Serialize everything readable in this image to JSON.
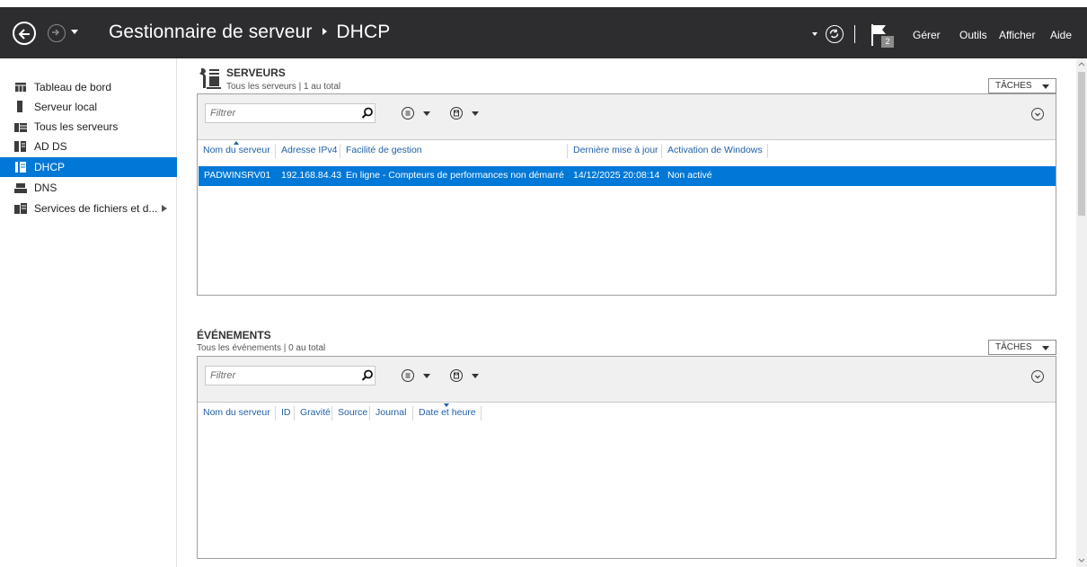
{
  "titlebar": {
    "title": "Gestionnaire de serveur",
    "section": "DHCP",
    "flag_count": "2",
    "menu": [
      "Gérer",
      "Outils",
      "Afficher",
      "Aide"
    ]
  },
  "sidebar": {
    "items": [
      {
        "label": "Tableau de bord",
        "icon": "dashboard-icon"
      },
      {
        "label": "Serveur local",
        "icon": "server-icon"
      },
      {
        "label": "Tous les serveurs",
        "icon": "servers-icon"
      },
      {
        "label": "AD DS",
        "icon": "adds-icon"
      },
      {
        "label": "DHCP",
        "icon": "dhcp-icon",
        "selected": true
      },
      {
        "label": "DNS",
        "icon": "dns-icon"
      },
      {
        "label": "Services de fichiers et d...",
        "icon": "file-services-icon",
        "has_submenu": true
      }
    ]
  },
  "servers": {
    "title": "SERVEURS",
    "subtitle": "Tous les serveurs | 1 au total",
    "tasks_label": "TÂCHES",
    "filter_placeholder": "Filtrer",
    "columns": [
      "Nom du serveur",
      "Adresse IPv4",
      "Facilité de gestion",
      "Dernière mise à jour",
      "Activation de Windows"
    ],
    "rows": [
      [
        "PADWINSRV01",
        "192.168.84.43",
        "En ligne - Compteurs de performances non démarré",
        "14/12/2025 20:08:14",
        "Non activé"
      ]
    ]
  },
  "events": {
    "title": "ÉVÉNEMENTS",
    "subtitle": "Tous les événements | 0 au total",
    "tasks_label": "TÂCHES",
    "filter_placeholder": "Filtrer",
    "columns": [
      "Nom du serveur",
      "ID",
      "Gravité",
      "Source",
      "Journal",
      "Date et heure"
    ]
  },
  "colors": {
    "titlebar": "#2d2d30",
    "selection": "#0078d7",
    "header_link": "#1f5fa8"
  }
}
